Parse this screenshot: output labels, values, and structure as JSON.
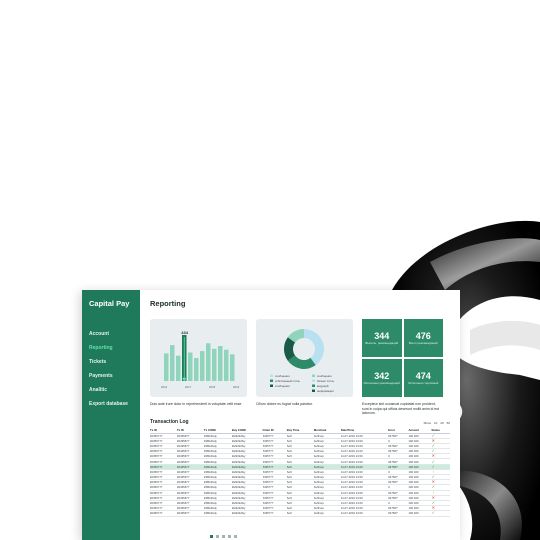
{
  "app": {
    "brand": "Capital Pay",
    "page_title": "Reporting"
  },
  "sidebar": {
    "items": [
      {
        "label": "Account",
        "active": false
      },
      {
        "label": "Reporting",
        "active": true
      },
      {
        "label": "Tickets",
        "active": false
      },
      {
        "label": "Payments",
        "active": false
      },
      {
        "label": "Analitic",
        "active": false
      },
      {
        "label": "Export database",
        "active": false
      }
    ]
  },
  "bar_card": {
    "peak_label": "434",
    "caption": "Duis aute irure dolor in reprehenderit in voluptate velit esse"
  },
  "donut_card": {
    "caption": "Cillum dolore eu fugiat nulla pariatur."
  },
  "kpis": [
    {
      "value": "344",
      "label": "Выполн. рекомендаций"
    },
    {
      "value": "476",
      "label": "Всего рекомендаций"
    },
    {
      "value": "342",
      "label": "Исполнено рекомендаций"
    },
    {
      "value": "474",
      "label": "Исполнено терпимый"
    }
  ],
  "kpi_caption": "Excepteur sint occaecat cupidatat non proident, sunt in culpa qui officia deserunt mollit anim id est laborum.",
  "log": {
    "title": "Transaction Log",
    "tools": [
      "Show",
      "10",
      "20",
      "50"
    ],
    "columns": [
      "Tx ID",
      "Tx ID",
      "Tx CODE",
      "Buy CODE",
      "Order ID",
      "Buy Time",
      "Merchant",
      "Date/Time",
      "Error",
      "Amount",
      "Status"
    ],
    "rows": [
      {
        "cells": [
          "#2356777",
          "#2435677",
          "#48hdfsdy",
          "#ahhfkdfsy",
          "#345777",
          "Soft",
          "buffcorp",
          "11-07-2019 13:00",
          "#4756?",
          "100 400",
          ""
        ],
        "status": "ok",
        "hl": false
      },
      {
        "cells": [
          "#2356777",
          "#2435677",
          "#48hdfsdy",
          "#ahhfkdfsy",
          "#345777",
          "Soft",
          "buffcorp",
          "11-07-2019 13:00",
          "0",
          "100 400",
          ""
        ],
        "status": "bad",
        "hl": false
      },
      {
        "cells": [
          "#2356777",
          "#2435677",
          "#48hdfsdy",
          "#ahhfkdfsy",
          "#345777",
          "Soft",
          "buffcorp",
          "11-07-2019 13:00",
          "#4756?",
          "100 400",
          ""
        ],
        "status": "ok",
        "hl": false
      },
      {
        "cells": [
          "#2356777",
          "#2435677",
          "#48hdfsdy",
          "#ahhfkdfsy",
          "#345777",
          "Soft",
          "buffcorp",
          "11-07-2019 13:00",
          "#4756?",
          "100 400",
          ""
        ],
        "status": "ok",
        "hl": false
      },
      {
        "cells": [
          "#2356777",
          "#2435677",
          "#48hdfsdy",
          "#ahhfkdfsy",
          "#345777",
          "Soft",
          "buffcorp",
          "11-07-2019 13:00",
          "0",
          "100 400",
          ""
        ],
        "status": "bad",
        "hl": false
      },
      {
        "cells": [
          "#2356777",
          "#2435677",
          "#48hdfsdy",
          "#ahhfkdfsy",
          "#345777",
          "Soft",
          "buffcorp",
          "11-07-2019 13:00",
          "#4756?",
          "100 400",
          ""
        ],
        "status": "ok",
        "hl": false
      },
      {
        "cells": [
          "#2356777",
          "#2435677",
          "#48hdfsdy",
          "#ahhfkdfsy",
          "#345777",
          "Soft",
          "buffcorp",
          "11-07-2019 13:00",
          "#4756?",
          "100 400",
          ""
        ],
        "status": "ok",
        "hl": true
      },
      {
        "cells": [
          "#2356777",
          "#2435677",
          "#48hdfsdy",
          "#ahhfkdfsy",
          "#345777",
          "Soft",
          "buffcorp",
          "11-07-2019 13:00",
          "0",
          "100 400",
          ""
        ],
        "status": "warn",
        "hl": false
      },
      {
        "cells": [
          "#2356777",
          "#2435677",
          "#48hdfsdy",
          "#ahhfkdfsy",
          "#345777",
          "Soft",
          "buffcorp",
          "11-07-2019 13:00",
          "#4756?",
          "100 400",
          ""
        ],
        "status": "ok",
        "hl": false
      },
      {
        "cells": [
          "#2356777",
          "#2435677",
          "#48hdfsdy",
          "#ahhfkdfsy",
          "#345777",
          "Soft",
          "buffcorp",
          "11-07-2019 13:00",
          "#4756?",
          "100 400",
          ""
        ],
        "status": "bad",
        "hl": false
      },
      {
        "cells": [
          "#2356777",
          "#2435677",
          "#48hdfsdy",
          "#ahhfkdfsy",
          "#345777",
          "Soft",
          "buffcorp",
          "11-07-2019 13:00",
          "0",
          "100 400",
          ""
        ],
        "status": "ok",
        "hl": false
      },
      {
        "cells": [
          "#2356777",
          "#2435677",
          "#48hdfsdy",
          "#ahhfkdfsy",
          "#345777",
          "Soft",
          "buffcorp",
          "11-07-2019 13:00",
          "#4756?",
          "100 400",
          ""
        ],
        "status": "warn",
        "hl": false
      },
      {
        "cells": [
          "#2356777",
          "#2435677",
          "#48hdfsdy",
          "#ahhfkdfsy",
          "#345777",
          "Soft",
          "buffcorp",
          "11-07-2019 13:00",
          "#4756?",
          "100 400",
          ""
        ],
        "status": "bad",
        "hl": false
      },
      {
        "cells": [
          "#2356777",
          "#2435677",
          "#48hdfsdy",
          "#ahhfkdfsy",
          "#345777",
          "Soft",
          "buffcorp",
          "11-07-2019 13:00",
          "0",
          "100 400",
          ""
        ],
        "status": "ok",
        "hl": false
      },
      {
        "cells": [
          "#2356777",
          "#2435677",
          "#48hdfsdy",
          "#ahhfkdfsy",
          "#345777",
          "Soft",
          "buffcorp",
          "11-07-2019 13:00",
          "#4756?",
          "100 400",
          ""
        ],
        "status": "bad",
        "hl": false
      },
      {
        "cells": [
          "#2356777",
          "#2435677",
          "#48hdfsdy",
          "#ahhfkdfsy",
          "#345777",
          "Soft",
          "buffcorp",
          "11-07-2019 13:00",
          "#4756?",
          "100 400",
          ""
        ],
        "status": "ok",
        "hl": false
      }
    ]
  },
  "chart_data": [
    {
      "type": "bar",
      "categories": [
        "1",
        "2",
        "3",
        "4",
        "5",
        "6",
        "7",
        "8",
        "9",
        "10",
        "11",
        "12"
      ],
      "x_tick_labels": [
        "2016",
        "2017",
        "2018",
        "2019"
      ],
      "values": [
        60,
        78,
        55,
        100,
        62,
        50,
        65,
        82,
        70,
        76,
        68,
        58
      ],
      "highlight_index": 3,
      "highlight_label": "434",
      "ylim": [
        0,
        100
      ],
      "colors": {
        "bar": "#8fd4bb",
        "highlight": "#1f7a5c"
      }
    },
    {
      "type": "pie",
      "donut": true,
      "values": [
        40,
        25,
        20,
        15
      ],
      "legend": [
        "сообщения",
        "собственный стиль",
        "сообщения",
        "сообщения",
        "бизнес стиль",
        "ведущий",
        "информация"
      ],
      "colors": [
        "#b8e0f0",
        "#2e8b6a",
        "#1a5a46",
        "#8fd4bb"
      ]
    }
  ],
  "colors": {
    "accent": "#1f7a5c",
    "active_nav": "#5fe3a8",
    "highlight_row": "#c9ecdc"
  }
}
